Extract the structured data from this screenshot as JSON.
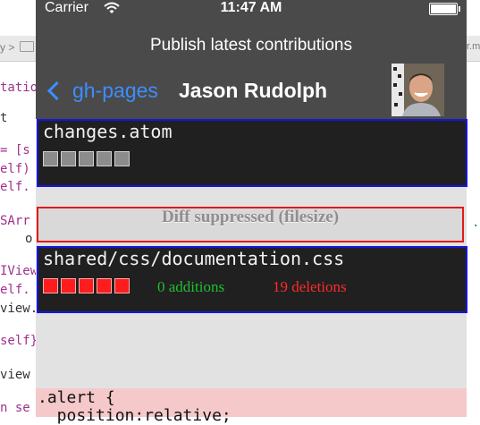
{
  "background_editor": {
    "path_fragment": "y >",
    "right_fragment": "r.m",
    "code_fragments": [
      "tatio",
      "t",
      "= [s",
      "elf)",
      "elf.",
      "SArr",
      "o",
      "IView",
      "elf.",
      "view.",
      "self}",
      "view",
      "n se"
    ],
    "code_fragment_colors": {
      "keyword": "#a0308d",
      "type": "#1f7a8a"
    },
    "right_edge_fragment": ".c"
  },
  "status_bar": {
    "carrier": "Carrier",
    "time": "11:47 AM"
  },
  "nav": {
    "subtitle": "Publish latest contributions",
    "back_label": "gh-pages",
    "title": "Jason Rudolph"
  },
  "files": [
    {
      "name": "changes.atom",
      "blocks": [
        "gray",
        "gray",
        "gray",
        "gray",
        "gray"
      ]
    },
    {
      "name": "shared/css/documentation.css",
      "blocks": [
        "red",
        "red",
        "red",
        "red",
        "red"
      ],
      "additions": "0 additions",
      "deletions": "19 deletions"
    }
  ],
  "suppressed_text": "Diff suppressed (filesize)",
  "code_preview": {
    "line1": ".alert {",
    "line2": "  position:relative;"
  },
  "colors": {
    "accent_blue": "#3d8eff",
    "row_border": "#1515e0",
    "suppressed_border": "#e01a1a",
    "additions": "#1fbf2f",
    "deletions": "#ff2b2b"
  }
}
